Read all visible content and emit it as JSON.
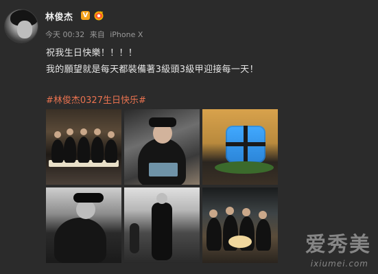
{
  "post": {
    "author_name": "林俊杰",
    "verified_mark": "V",
    "meta": {
      "time": "今天 00:32",
      "source_prefix": "来自",
      "device": "iPhone X"
    },
    "text_line_1": "祝我生日快樂！！！！",
    "text_line_2": "我的願望就是每天都裝備著3級頭3級甲迎接每一天！",
    "hashtag": "#林俊杰0327生日快乐#",
    "photos": [
      {
        "name": "photo-group-table"
      },
      {
        "name": "photo-man-with-cake"
      },
      {
        "name": "photo-airdrop-cake"
      },
      {
        "name": "photo-man-cap-bw"
      },
      {
        "name": "photo-man-standing-bw"
      },
      {
        "name": "photo-group-cake-candles"
      }
    ]
  },
  "watermark": {
    "title": "爱秀美",
    "sub": "ixiumei.com"
  },
  "colors": {
    "background": "#2b2b2b",
    "hashtag": "#eb7350",
    "verified": "#f4a21a",
    "meta_text": "#9a9a9a"
  },
  "icons": {
    "verified": "verified-badge-icon",
    "level": "level-badge-icon"
  }
}
